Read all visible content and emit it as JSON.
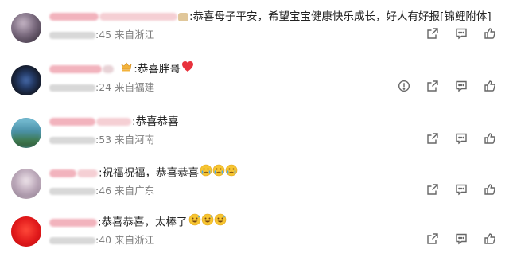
{
  "comments": [
    {
      "text": ":恭喜母子平安，希望宝宝健康快乐成长，好人有好报[锦鲤附体]",
      "time": ":45",
      "location": "来自浙江",
      "actions": [
        "share-icon",
        "reply-icon",
        "like-icon"
      ]
    },
    {
      "text": ":恭喜胖哥",
      "time": ":24",
      "location": "来自福建",
      "actions": [
        "report-icon",
        "share-icon",
        "reply-icon",
        "like-icon"
      ]
    },
    {
      "text": ":恭喜恭喜",
      "time": ":53",
      "location": "来自河南",
      "actions": [
        "share-icon",
        "reply-icon",
        "like-icon"
      ]
    },
    {
      "text": ":祝福祝福，恭喜恭喜",
      "time": ":46",
      "location": "来自广东",
      "actions": [
        "share-icon",
        "reply-icon",
        "like-icon"
      ]
    },
    {
      "text": ":恭喜恭喜，太棒了",
      "time": ":40",
      "location": "来自浙江",
      "actions": [
        "share-icon",
        "reply-icon",
        "like-icon"
      ]
    }
  ],
  "colors": {
    "text": "#222222",
    "meta": "#808080",
    "icon": "#666666",
    "heart": "#e8323c",
    "emoji": "#f7c531"
  }
}
